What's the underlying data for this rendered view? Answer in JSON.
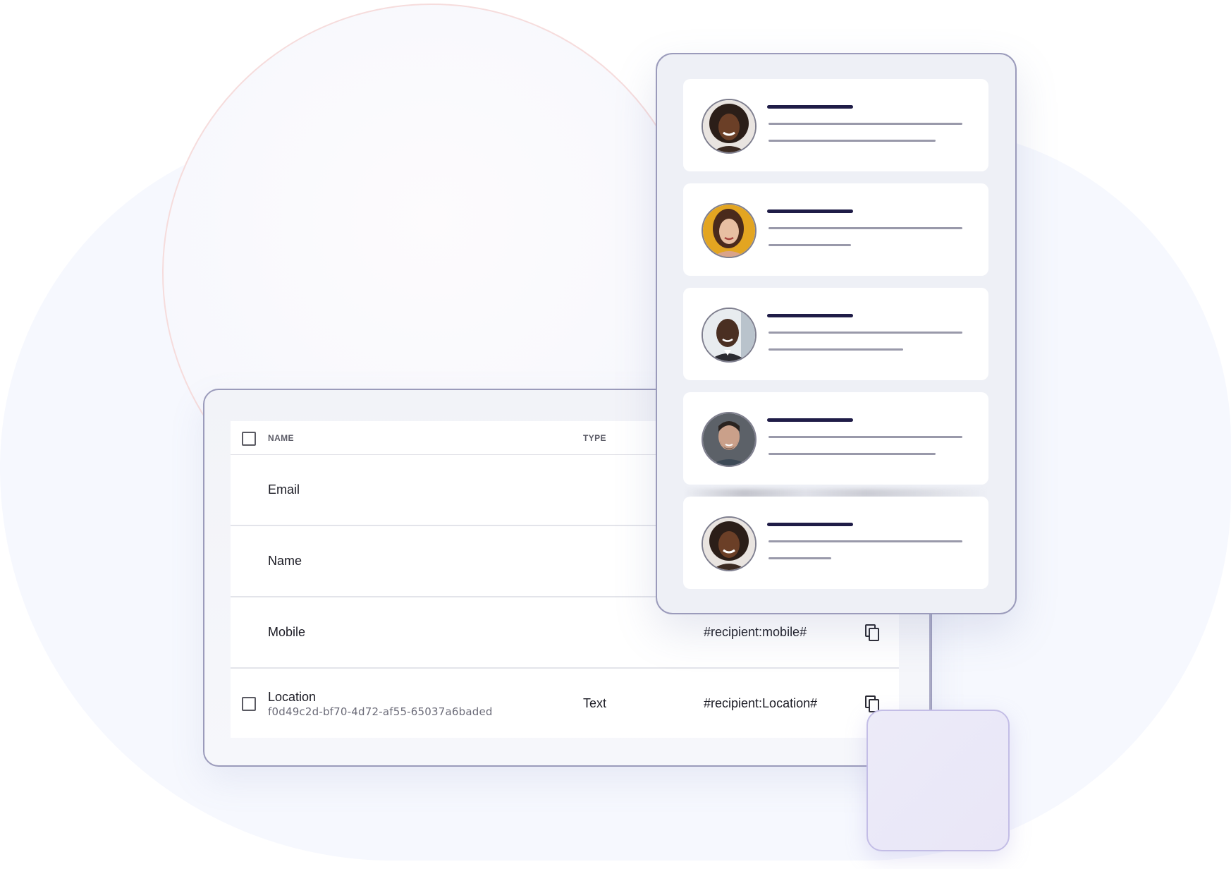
{
  "table": {
    "headers": {
      "name": "NAME",
      "type": "TYPE"
    },
    "rows": [
      {
        "name": "Email"
      },
      {
        "name": "Name"
      },
      {
        "name": "Mobile",
        "code": "#recipient:mobile#"
      },
      {
        "name": "Location",
        "id": "f0d49c2d-bf70-4d72-af55-65037a6baded",
        "type": "Text",
        "code": "#recipient:Location#"
      }
    ]
  },
  "contacts": {
    "items": [
      {
        "avatar": "avatar-woman-curly-hair"
      },
      {
        "avatar": "avatar-woman-yellow-background"
      },
      {
        "avatar": "avatar-man-suit"
      },
      {
        "avatar": "avatar-man-beard"
      },
      {
        "avatar": "avatar-woman-curly-hair"
      }
    ]
  },
  "colors": {
    "accent_dark": "#1f1c47",
    "border": "#9b9bbb",
    "background_blob": "#f6f8fe",
    "glass_square": "#e9e6f7"
  }
}
